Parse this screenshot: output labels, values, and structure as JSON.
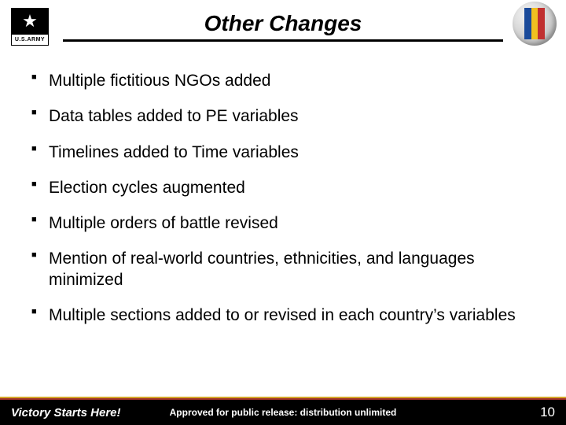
{
  "header": {
    "title": "Other Changes",
    "army_label": "U.S.ARMY"
  },
  "bullets": [
    "Multiple fictitious NGOs added",
    "Data tables added to PE variables",
    "Timelines added to Time variables",
    "Election cycles augmented",
    "Multiple orders of battle revised",
    "Mention of real-world countries, ethnicities, and languages minimized",
    "Multiple sections added to or revised in each country’s variables"
  ],
  "footer": {
    "left": "Victory Starts Here!",
    "center": "Approved for public release: distribution unlimited",
    "page": "10"
  },
  "colors": {
    "accent_yellow": "#d4a528",
    "accent_red": "#a03028",
    "bar_black": "#000000"
  }
}
